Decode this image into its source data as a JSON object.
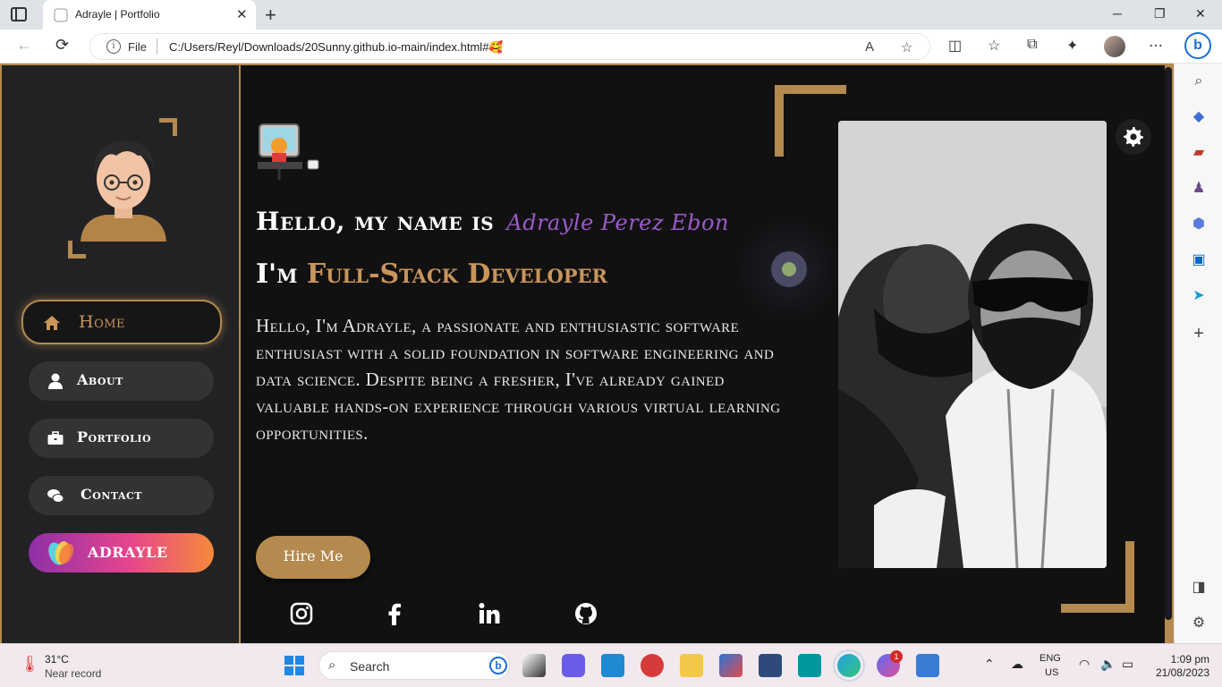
{
  "browser": {
    "tab_title": "Adrayle | Portfolio",
    "tab_close": "✕",
    "new_tab": "+",
    "url_scheme_label": "File",
    "url": "C:/Users/Reyl/Downloads/20Sunny.github.io-main/index.html#🥰",
    "window_controls": {
      "minimize": "─",
      "maximize": "❐",
      "close": "✕"
    }
  },
  "sidebar": {
    "nav": [
      {
        "label": "Home",
        "icon": "home-icon",
        "active": true
      },
      {
        "label": "About",
        "icon": "user-icon"
      },
      {
        "label": "Portfolio",
        "icon": "briefcase-icon"
      },
      {
        "label": "Contact",
        "icon": "chat-icon"
      },
      {
        "label": "ADRAYLE",
        "icon": "adrayle-logo-icon"
      }
    ]
  },
  "hero": {
    "greeting": "Hello, my name is",
    "name": "Adrayle Perez Ebon",
    "im_prefix": "I'm",
    "role": "Full-Stack Developer",
    "bio": "Hello, I'm Adrayle, a passionate and enthusiastic software enthusiast with a solid foundation in software engineering and data science. Despite being a fresher, I've already gained valuable hands-on experience through various virtual learning opportunities.",
    "hire_button": "Hire Me",
    "socials": [
      "instagram-icon",
      "facebook-icon",
      "linkedin-icon",
      "github-icon"
    ]
  },
  "colors": {
    "accent": "#b48a4e",
    "background": "#121112",
    "sidebar": "#222224",
    "name_purple": "#9b5ac8"
  },
  "taskbar": {
    "weather_temp": "31°C",
    "weather_desc": "Near record",
    "search_label": "Search",
    "lang_top": "ENG",
    "lang_bottom": "US",
    "time": "1:09 pm",
    "date": "21/08/2023",
    "messenger_badge": "1"
  }
}
